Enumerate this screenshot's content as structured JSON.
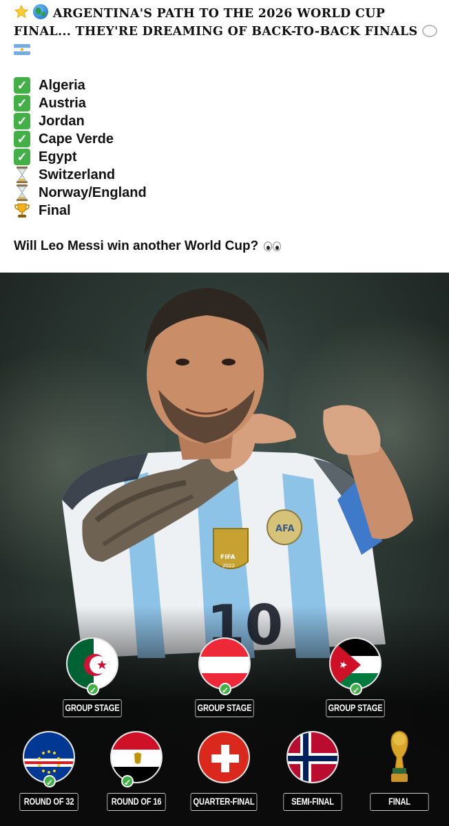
{
  "post": {
    "headline": "ARGENTINA'S PATH TO THE 2026 WORLD CUP FINAL... THEY'RE DREAMING OF BACK-TO-BACK FINALS",
    "path": [
      {
        "team": "Algeria",
        "status": "check-icon"
      },
      {
        "team": "Austria",
        "status": "check-icon"
      },
      {
        "team": "Jordan",
        "status": "check-icon"
      },
      {
        "team": "Cape Verde",
        "status": "check-icon"
      },
      {
        "team": "Egypt",
        "status": "check-icon"
      },
      {
        "team": "Switzerland",
        "status": "hourglass-icon"
      },
      {
        "team": "Norway/England",
        "status": "hourglass-icon"
      },
      {
        "team": "Final",
        "status": "trophy-icon"
      }
    ],
    "question": "Will Leo Messi win another World Cup?"
  },
  "graphic": {
    "group_stage": [
      {
        "label": "GROUP STAGE",
        "team": "Algeria",
        "completed": true
      },
      {
        "label": "GROUP STAGE",
        "team": "Austria",
        "completed": true
      },
      {
        "label": "GROUP STAGE",
        "team": "Jordan",
        "completed": true
      }
    ],
    "knockout": [
      {
        "label": "ROUND OF 32",
        "team": "Cape Verde",
        "completed": true
      },
      {
        "label": "ROUND OF 16",
        "team": "Egypt",
        "completed": true
      },
      {
        "label": "QUARTER-FINAL",
        "team": "Switzerland",
        "completed": false
      },
      {
        "label": "SEMI-FINAL",
        "team": "Norway",
        "completed": false
      },
      {
        "label": "FINAL",
        "team": "World Cup trophy",
        "completed": false
      }
    ],
    "jersey": {
      "number": "10",
      "badge_text": "FIFA",
      "badge_year": "2022",
      "crest_text": "AFA"
    }
  },
  "colors": {
    "check": "#43b047",
    "argentina_sky": "#74acdf",
    "label_border": "#cfcfcf"
  }
}
